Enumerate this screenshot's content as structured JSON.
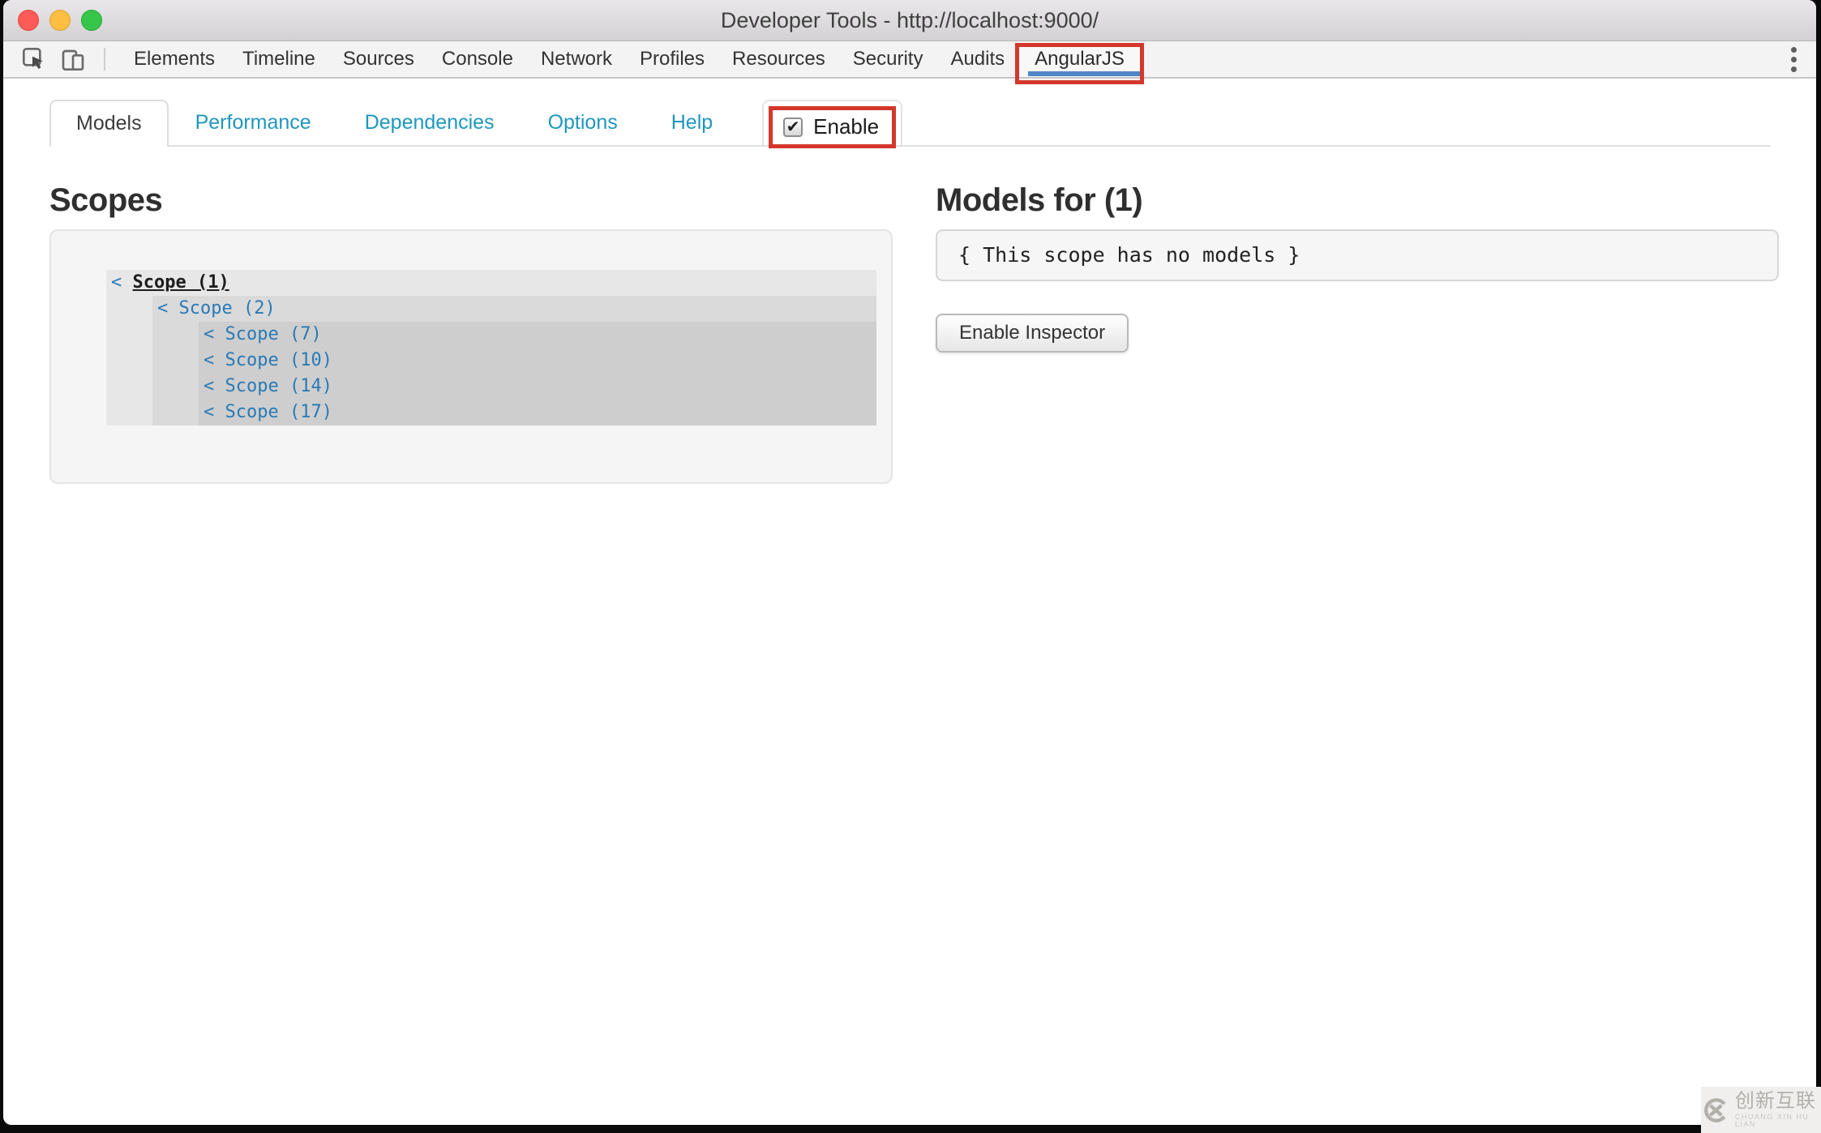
{
  "window": {
    "title": "Developer Tools - http://localhost:9000/"
  },
  "devtools_toolbar": {
    "tabs": [
      "Elements",
      "Timeline",
      "Sources",
      "Console",
      "Network",
      "Profiles",
      "Resources",
      "Security",
      "Audits"
    ],
    "active_tab": "AngularJS",
    "icons": [
      "inspect-element-icon",
      "device-toolbar-icon",
      "overflow-menu-icon"
    ]
  },
  "subtabs": {
    "active": "Models",
    "links": [
      "Performance",
      "Dependencies",
      "Options",
      "Help"
    ],
    "enable_checkbox": {
      "label": "Enable",
      "checked": true,
      "check_glyph": "✔"
    }
  },
  "scopes_panel": {
    "heading": "Scopes",
    "caret": "<",
    "scopes": [
      {
        "label": "Scope (1)",
        "selected": true,
        "children": [
          {
            "label": "Scope (2)",
            "children": [
              {
                "label": "Scope (7)"
              },
              {
                "label": "Scope (10)"
              },
              {
                "label": "Scope (14)"
              },
              {
                "label": "Scope (17)"
              }
            ]
          }
        ]
      }
    ]
  },
  "models_panel": {
    "heading": "Models for (1)",
    "empty_message": "{ This scope has no models }",
    "button_label": "Enable Inspector"
  },
  "watermark": {
    "text": "创新互联",
    "subtext": "CHUANG XIN HU LIAN"
  },
  "colors": {
    "annotation_red": "#d4372b",
    "active_tab_underline_blue": "#4e86c6",
    "subtab_link_blue": "#1f97be",
    "scope_link_blue": "#2a7ab5",
    "traffic_red": "#fc5b57",
    "traffic_yellow": "#fdbe41",
    "traffic_green": "#35c64a"
  }
}
